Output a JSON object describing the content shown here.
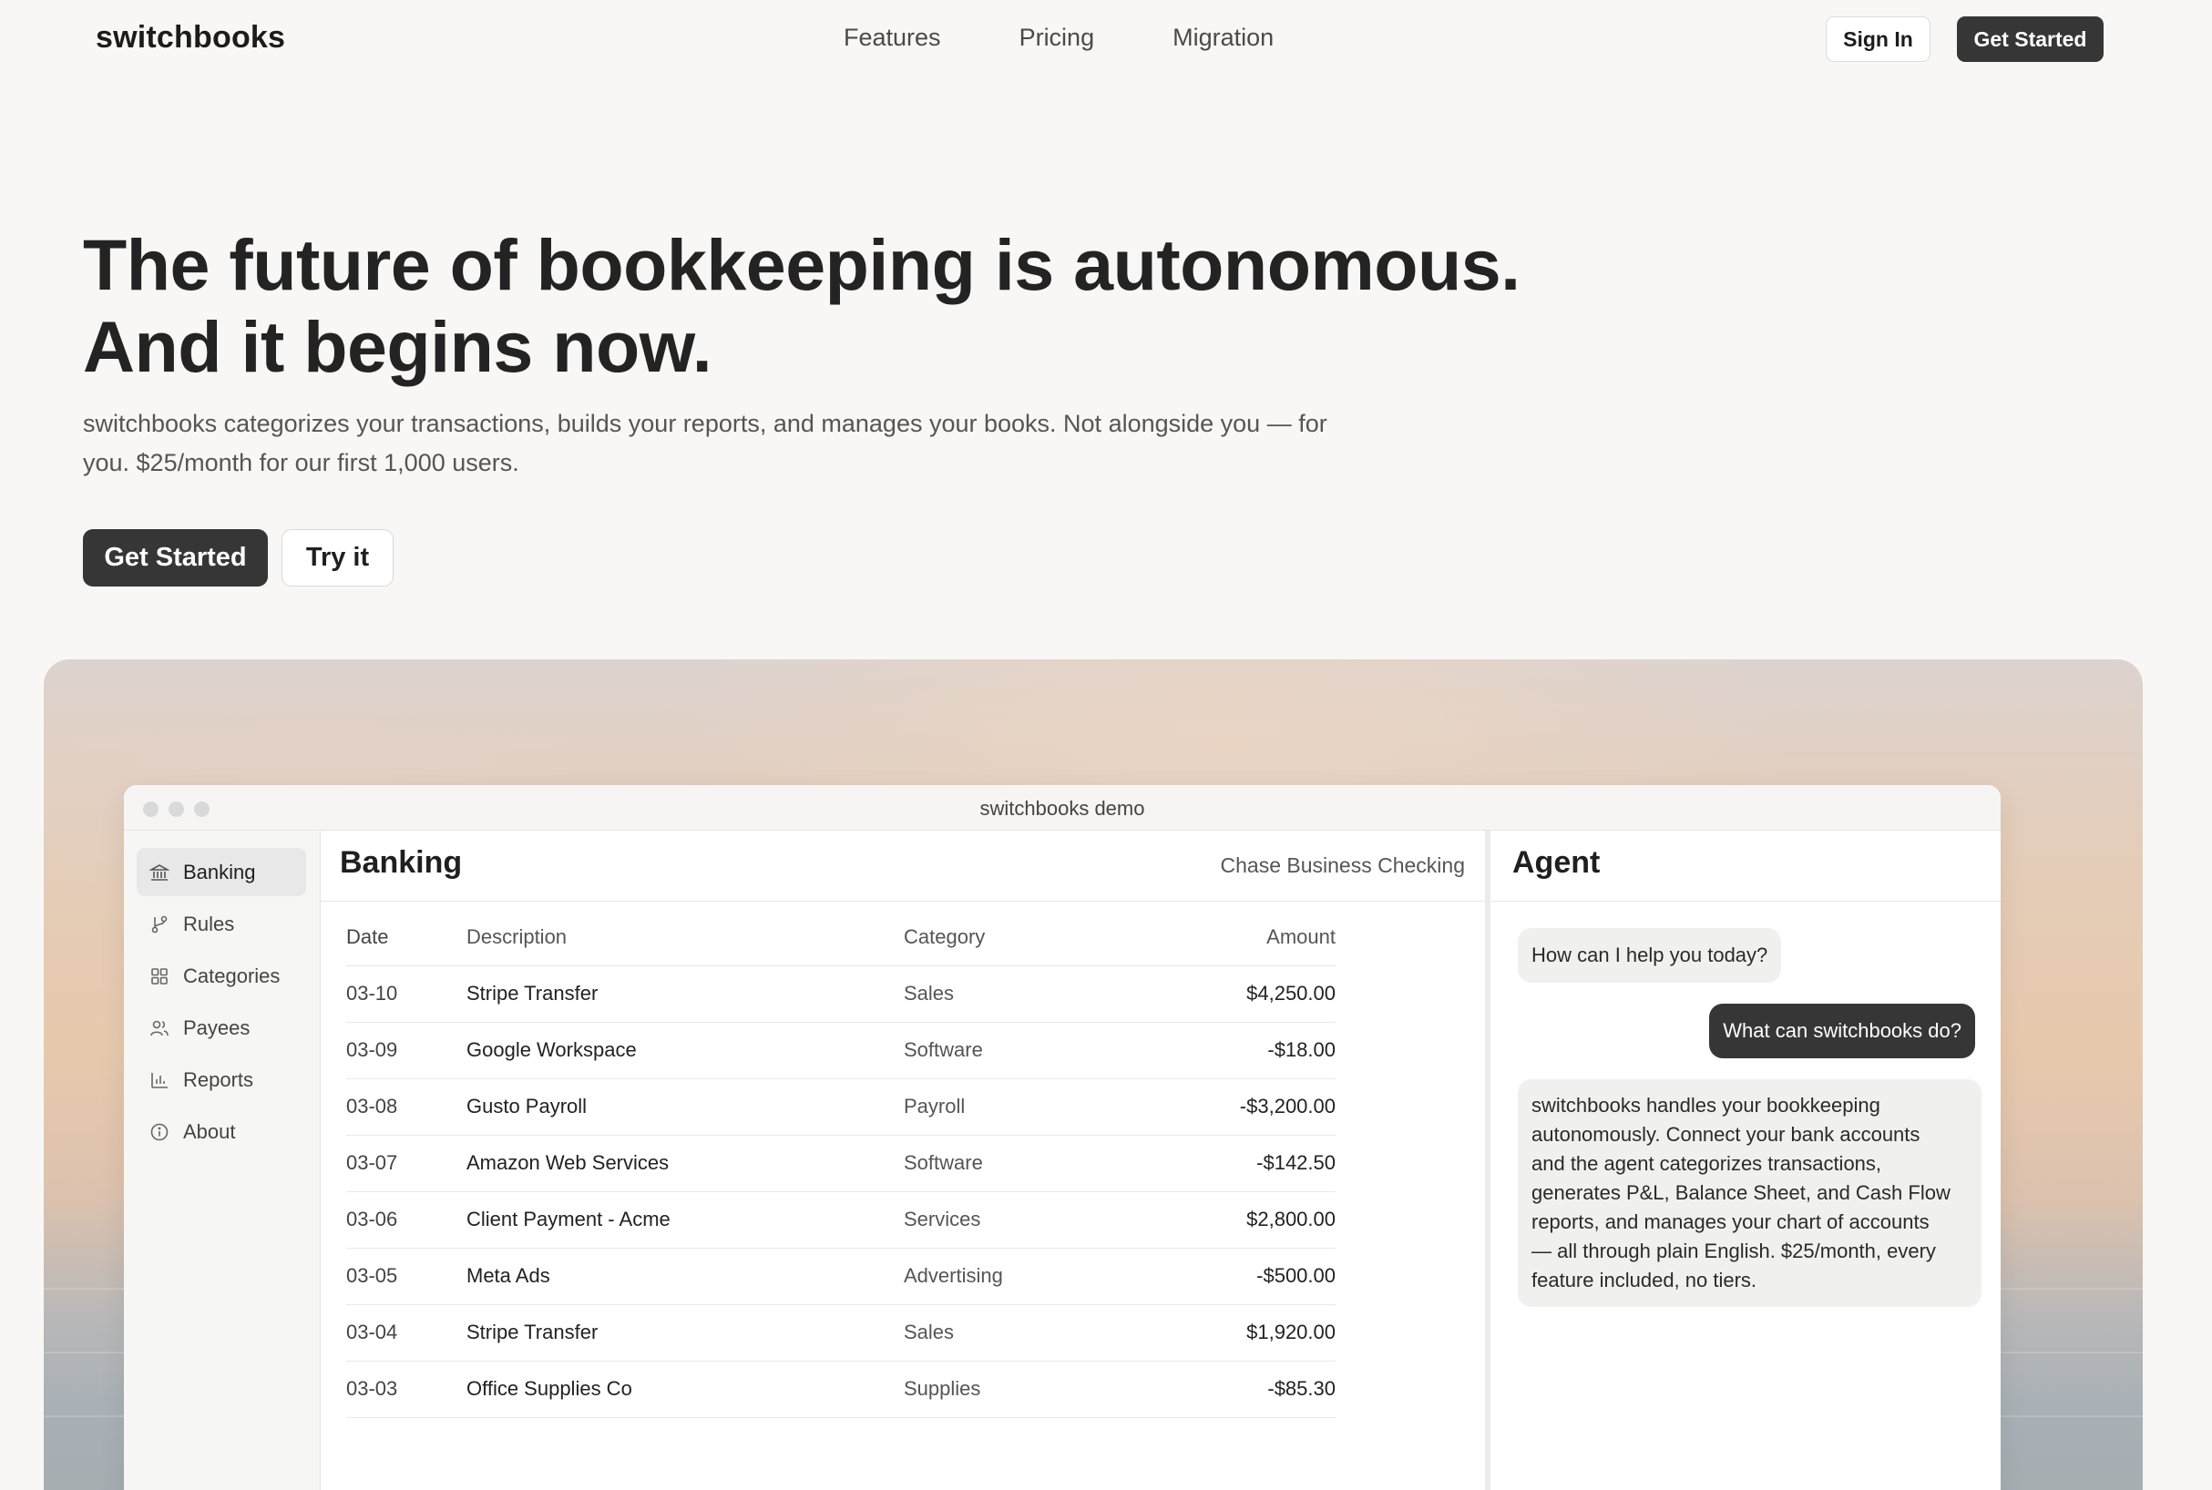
{
  "nav": {
    "brand": "switchbooks",
    "links": [
      "Features",
      "Pricing",
      "Migration"
    ],
    "sign_in": "Sign In",
    "get_started": "Get Started"
  },
  "hero": {
    "title_line1": "The future of bookkeeping is autonomous.",
    "title_line2": "And it begins now.",
    "subtitle_line1": "switchbooks categorizes your transactions, builds your reports, and manages your books. Not alongside you — for",
    "subtitle_line2": "you. $25/month for our first 1,000 users.",
    "cta_primary": "Get Started",
    "cta_secondary": "Try it"
  },
  "demo": {
    "window_title": "switchbooks demo",
    "sidebar": [
      {
        "label": "Banking",
        "icon": "bank-icon",
        "active": true
      },
      {
        "label": "Rules",
        "icon": "branch-icon",
        "active": false
      },
      {
        "label": "Categories",
        "icon": "grid-icon",
        "active": false
      },
      {
        "label": "Payees",
        "icon": "users-icon",
        "active": false
      },
      {
        "label": "Reports",
        "icon": "bar-chart-icon",
        "active": false
      },
      {
        "label": "About",
        "icon": "info-icon",
        "active": false
      }
    ],
    "banking": {
      "title": "Banking",
      "account": "Chase Business Checking",
      "columns": [
        "Date",
        "Description",
        "Category",
        "Amount"
      ],
      "rows": [
        {
          "date": "03-10",
          "description": "Stripe Transfer",
          "category": "Sales",
          "amount": "$4,250.00",
          "positive": true
        },
        {
          "date": "03-09",
          "description": "Google Workspace",
          "category": "Software",
          "amount": "-$18.00",
          "positive": false
        },
        {
          "date": "03-08",
          "description": "Gusto Payroll",
          "category": "Payroll",
          "amount": "-$3,200.00",
          "positive": false
        },
        {
          "date": "03-07",
          "description": "Amazon Web Services",
          "category": "Software",
          "amount": "-$142.50",
          "positive": false
        },
        {
          "date": "03-06",
          "description": "Client Payment - Acme",
          "category": "Services",
          "amount": "$2,800.00",
          "positive": true
        },
        {
          "date": "03-05",
          "description": "Meta Ads",
          "category": "Advertising",
          "amount": "-$500.00",
          "positive": false
        },
        {
          "date": "03-04",
          "description": "Stripe Transfer",
          "category": "Sales",
          "amount": "$1,920.00",
          "positive": true
        },
        {
          "date": "03-03",
          "description": "Office Supplies Co",
          "category": "Supplies",
          "amount": "-$85.30",
          "positive": false
        }
      ]
    },
    "agent": {
      "title": "Agent",
      "messages": [
        {
          "from": "agent",
          "text": "How can I help you today?"
        },
        {
          "from": "user",
          "text": "What can switchbooks do?"
        },
        {
          "from": "agent",
          "lines": [
            "switchbooks handles your bookkeeping",
            "autonomously. Connect your bank accounts",
            "and the agent categorizes transactions,",
            "generates P&L, Balance Sheet, and Cash Flow",
            "reports, and manages your chart of accounts",
            "— all through plain English. $25/month, every",
            "feature included, no tiers."
          ]
        }
      ]
    }
  },
  "colors": {
    "background": "#f8f7f5",
    "dark_button": "#363636",
    "positive_amount": "#3aa56a"
  }
}
